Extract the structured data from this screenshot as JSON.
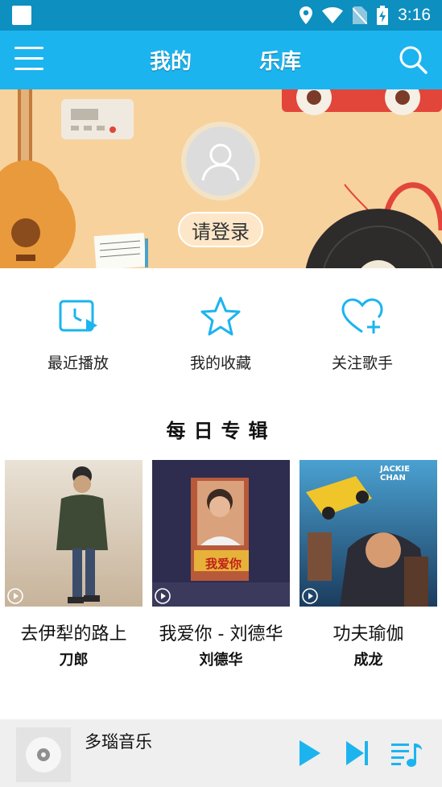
{
  "status_bar": {
    "time": "3:16"
  },
  "header": {
    "tabs": [
      {
        "label": "我的"
      },
      {
        "label": "乐库"
      }
    ]
  },
  "banner": {
    "login_label": "请登录"
  },
  "quick_actions": [
    {
      "label": "最近播放",
      "icon": "recent-play-icon"
    },
    {
      "label": "我的收藏",
      "icon": "star-icon"
    },
    {
      "label": "关注歌手",
      "icon": "heart-plus-icon"
    }
  ],
  "section": {
    "title": "每日专辑"
  },
  "albums": [
    {
      "title": "去伊犁的路上",
      "artist": "刀郎"
    },
    {
      "title": "我爱你 - 刘德华",
      "artist": "刘德华",
      "cover_text": "我爱你"
    },
    {
      "title": "功夫瑜伽",
      "artist": "成龙",
      "cover_text": "JACKIE CHAN"
    }
  ],
  "player": {
    "track": "多瑙音乐"
  },
  "colors": {
    "status_bar": "#0d8fc0",
    "app_bar": "#1cb4ef",
    "accent": "#1cb4ef",
    "banner": "#f8d29d",
    "player_bg": "#efefef"
  }
}
